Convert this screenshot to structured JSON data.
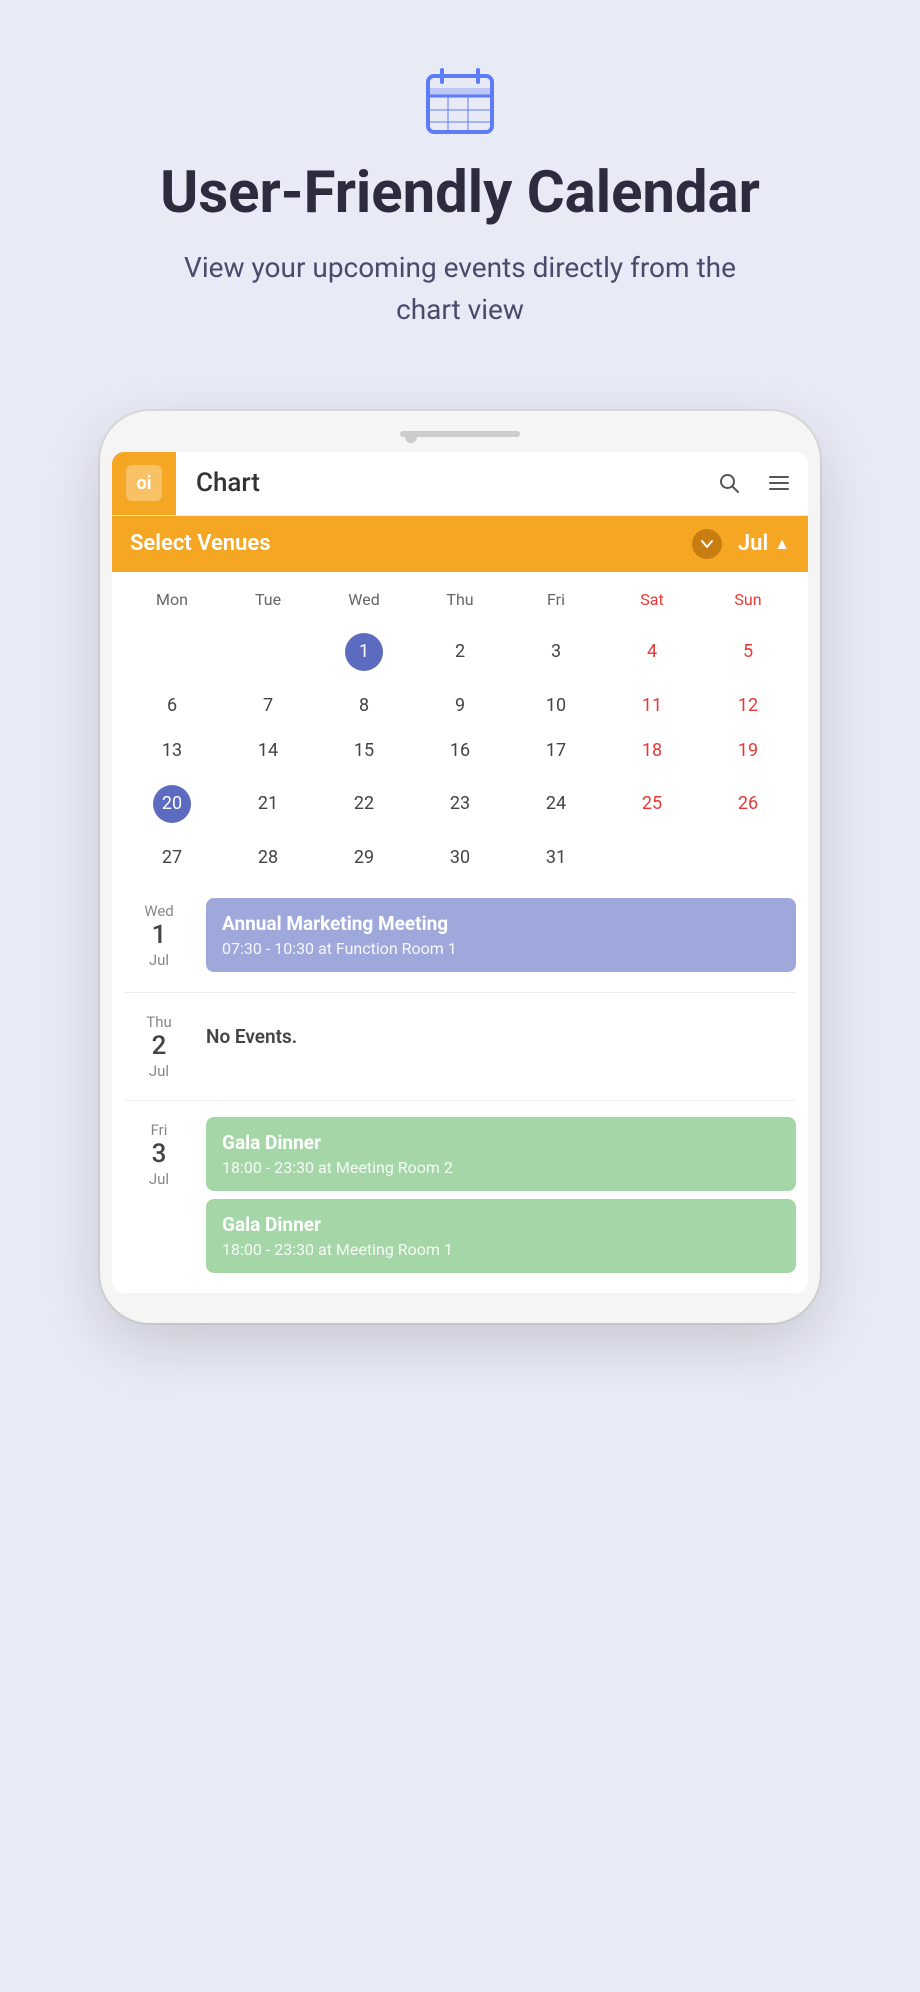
{
  "hero": {
    "title": "User-Friendly Calendar",
    "subtitle": "View your upcoming events directly from the chart view",
    "icon_label": "calendar-icon"
  },
  "app": {
    "logo_text": "oi",
    "title": "Chart",
    "search_icon": "🔍",
    "menu_icon": "☰"
  },
  "venue_bar": {
    "label": "Select Venues",
    "dropdown_icon": "▼",
    "month": "Jul",
    "month_arrow": "▲"
  },
  "calendar": {
    "day_headers": [
      "Mon",
      "Tue",
      "Wed",
      "Thu",
      "Fri",
      "Sat",
      "Sun"
    ],
    "weeks": [
      [
        null,
        null,
        "1",
        "2",
        "3",
        "4",
        "5"
      ],
      [
        "6",
        "7",
        "8",
        "9",
        "10",
        "11",
        "12"
      ],
      [
        "13",
        "14",
        "15",
        "16",
        "17",
        "18",
        "19"
      ],
      [
        "20",
        "21",
        "22",
        "23",
        "24",
        "25",
        "26"
      ],
      [
        "27",
        "28",
        "29",
        "30",
        "31",
        null,
        null
      ]
    ],
    "today": "1",
    "current_day": "20"
  },
  "events": [
    {
      "day_name": "Wed",
      "day_num": "1",
      "month": "Jul",
      "cards": [
        {
          "title": "Annual Marketing Meeting",
          "detail": "07:30 - 10:30 at Function Room 1",
          "color": "purple"
        }
      ]
    },
    {
      "day_name": "Thu",
      "day_num": "2",
      "month": "Jul",
      "cards": [],
      "no_events": "No Events."
    },
    {
      "day_name": "Fri",
      "day_num": "3",
      "month": "Jul",
      "cards": [
        {
          "title": "Gala Dinner",
          "detail": "18:00 - 23:30 at Meeting Room 2",
          "color": "green"
        },
        {
          "title": "Gala Dinner",
          "detail": "18:00 - 23:30 at Meeting Room 1",
          "color": "green"
        }
      ]
    }
  ]
}
